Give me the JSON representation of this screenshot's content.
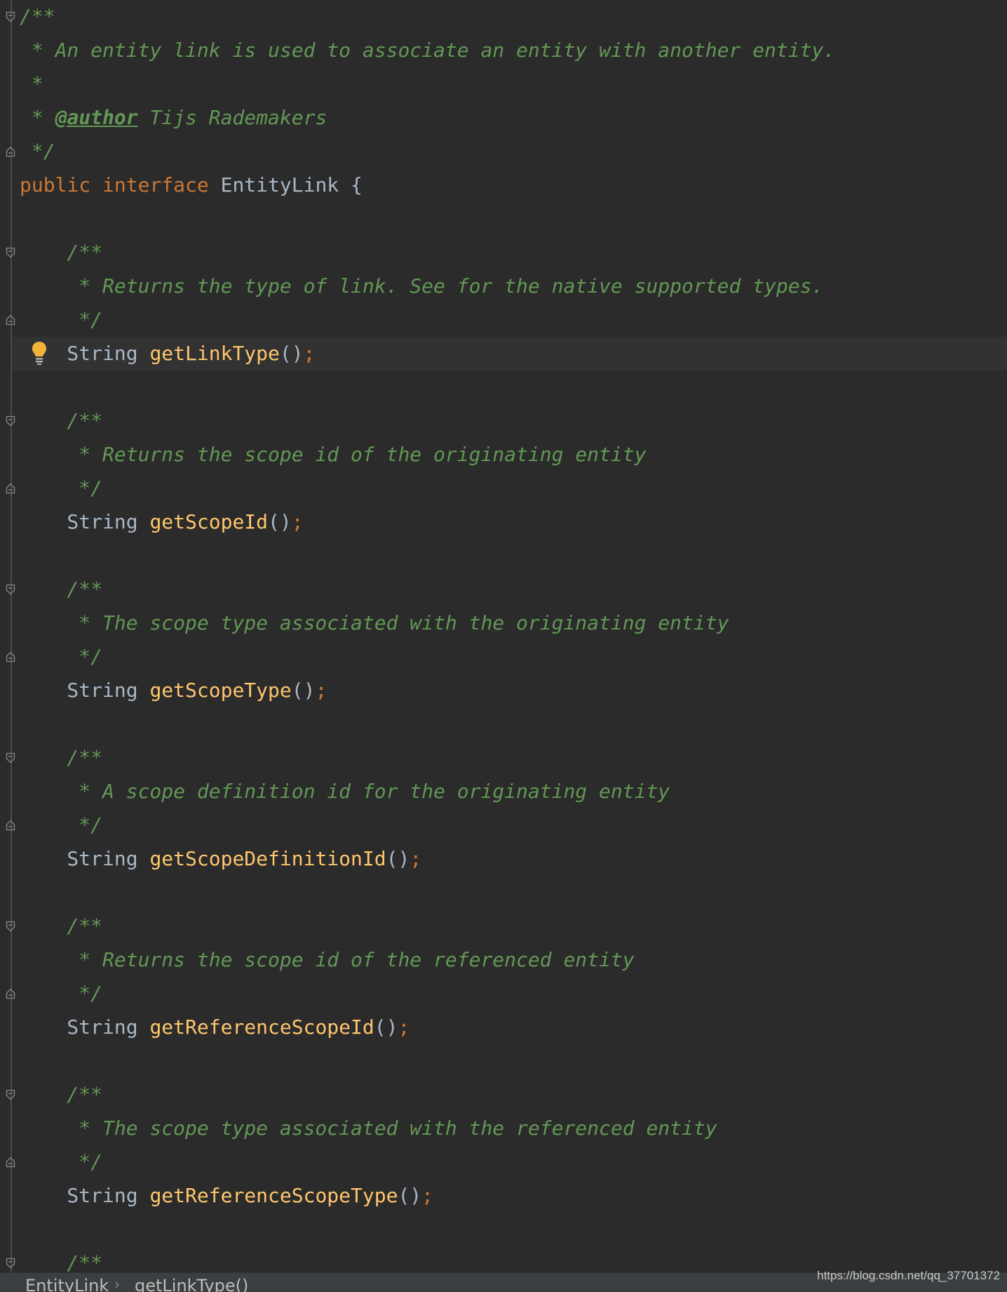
{
  "editor": {
    "lines": [
      [
        {
          "t": "/**",
          "c": "doc"
        }
      ],
      [
        {
          "t": " * An entity link is used to associate an entity with another entity.",
          "c": "doc"
        }
      ],
      [
        {
          "t": " *",
          "c": "doc"
        }
      ],
      [
        {
          "t": " * ",
          "c": "doc"
        },
        {
          "t": "@author",
          "c": "doc-tag"
        },
        {
          "t": " Tijs Rademakers",
          "c": "doc"
        }
      ],
      [
        {
          "t": " */",
          "c": "doc"
        }
      ],
      [
        {
          "t": "public ",
          "c": "kw"
        },
        {
          "t": "interface ",
          "c": "kw"
        },
        {
          "t": "EntityLink {",
          "c": "plain"
        }
      ],
      [],
      [
        {
          "t": "    /**",
          "c": "doc"
        }
      ],
      [
        {
          "t": "     * Returns the type of link. See for the native supported types.",
          "c": "doc"
        }
      ],
      [
        {
          "t": "     */",
          "c": "doc"
        }
      ],
      [
        {
          "t": "    String ",
          "c": "type"
        },
        {
          "t": "getLinkType",
          "c": "method"
        },
        {
          "t": "()",
          "c": "plain"
        },
        {
          "t": ";",
          "c": "semi"
        }
      ],
      [],
      [
        {
          "t": "    /**",
          "c": "doc"
        }
      ],
      [
        {
          "t": "     * Returns the scope id of the originating entity",
          "c": "doc"
        }
      ],
      [
        {
          "t": "     */",
          "c": "doc"
        }
      ],
      [
        {
          "t": "    String ",
          "c": "type"
        },
        {
          "t": "getScopeId",
          "c": "method"
        },
        {
          "t": "()",
          "c": "plain"
        },
        {
          "t": ";",
          "c": "semi"
        }
      ],
      [],
      [
        {
          "t": "    /**",
          "c": "doc"
        }
      ],
      [
        {
          "t": "     * The scope type associated with the originating entity",
          "c": "doc"
        }
      ],
      [
        {
          "t": "     */",
          "c": "doc"
        }
      ],
      [
        {
          "t": "    String ",
          "c": "type"
        },
        {
          "t": "getScopeType",
          "c": "method"
        },
        {
          "t": "()",
          "c": "plain"
        },
        {
          "t": ";",
          "c": "semi"
        }
      ],
      [],
      [
        {
          "t": "    /**",
          "c": "doc"
        }
      ],
      [
        {
          "t": "     * A scope definition id for the originating entity",
          "c": "doc"
        }
      ],
      [
        {
          "t": "     */",
          "c": "doc"
        }
      ],
      [
        {
          "t": "    String ",
          "c": "type"
        },
        {
          "t": "getScopeDefinitionId",
          "c": "method"
        },
        {
          "t": "()",
          "c": "plain"
        },
        {
          "t": ";",
          "c": "semi"
        }
      ],
      [],
      [
        {
          "t": "    /**",
          "c": "doc"
        }
      ],
      [
        {
          "t": "     * Returns the scope id of the referenced entity",
          "c": "doc"
        }
      ],
      [
        {
          "t": "     */",
          "c": "doc"
        }
      ],
      [
        {
          "t": "    String ",
          "c": "type"
        },
        {
          "t": "getReferenceScopeId",
          "c": "method"
        },
        {
          "t": "()",
          "c": "plain"
        },
        {
          "t": ";",
          "c": "semi"
        }
      ],
      [],
      [
        {
          "t": "    /**",
          "c": "doc"
        }
      ],
      [
        {
          "t": "     * The scope type associated with the referenced entity",
          "c": "doc"
        }
      ],
      [
        {
          "t": "     */",
          "c": "doc"
        }
      ],
      [
        {
          "t": "    String ",
          "c": "type"
        },
        {
          "t": "getReferenceScopeType",
          "c": "method"
        },
        {
          "t": "()",
          "c": "plain"
        },
        {
          "t": ";",
          "c": "semi"
        }
      ],
      [],
      [
        {
          "t": "    /**",
          "c": "doc"
        }
      ]
    ],
    "fold_open_lines": [
      0,
      7,
      12,
      17,
      22,
      27,
      32,
      37
    ],
    "fold_close_lines": [
      4,
      9,
      14,
      19,
      24,
      29,
      34
    ],
    "caret_line": 10,
    "intention_icon": "lightbulb-icon"
  },
  "breadcrumb": {
    "items": [
      "EntityLink",
      "getLinkType()"
    ],
    "separator": "›"
  },
  "watermark": "https://blog.csdn.net/qq_37701372",
  "colors": {
    "background": "#2b2b2b",
    "doc_comment": "#629755",
    "keyword": "#cc7832",
    "plain": "#a9b7c6",
    "method": "#ffc66d",
    "bulb": "#f2b33a"
  }
}
